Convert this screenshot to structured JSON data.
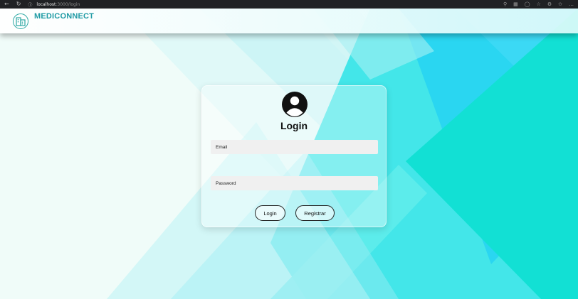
{
  "browser": {
    "url_host": "localhost",
    "url_path": ":3000/login"
  },
  "header": {
    "brand": "MEDICONNECT",
    "logo_icon": "hospital-building-icon"
  },
  "login_card": {
    "avatar_icon": "user-avatar-icon",
    "title": "Login",
    "email_placeholder": "Email",
    "password_placeholder": "Password",
    "login_button": "Login",
    "register_button": "Registrar"
  },
  "colors": {
    "brand": "#1e9aa4",
    "accent_cyan": "#27d7f4",
    "accent_teal": "#15e1d3"
  }
}
